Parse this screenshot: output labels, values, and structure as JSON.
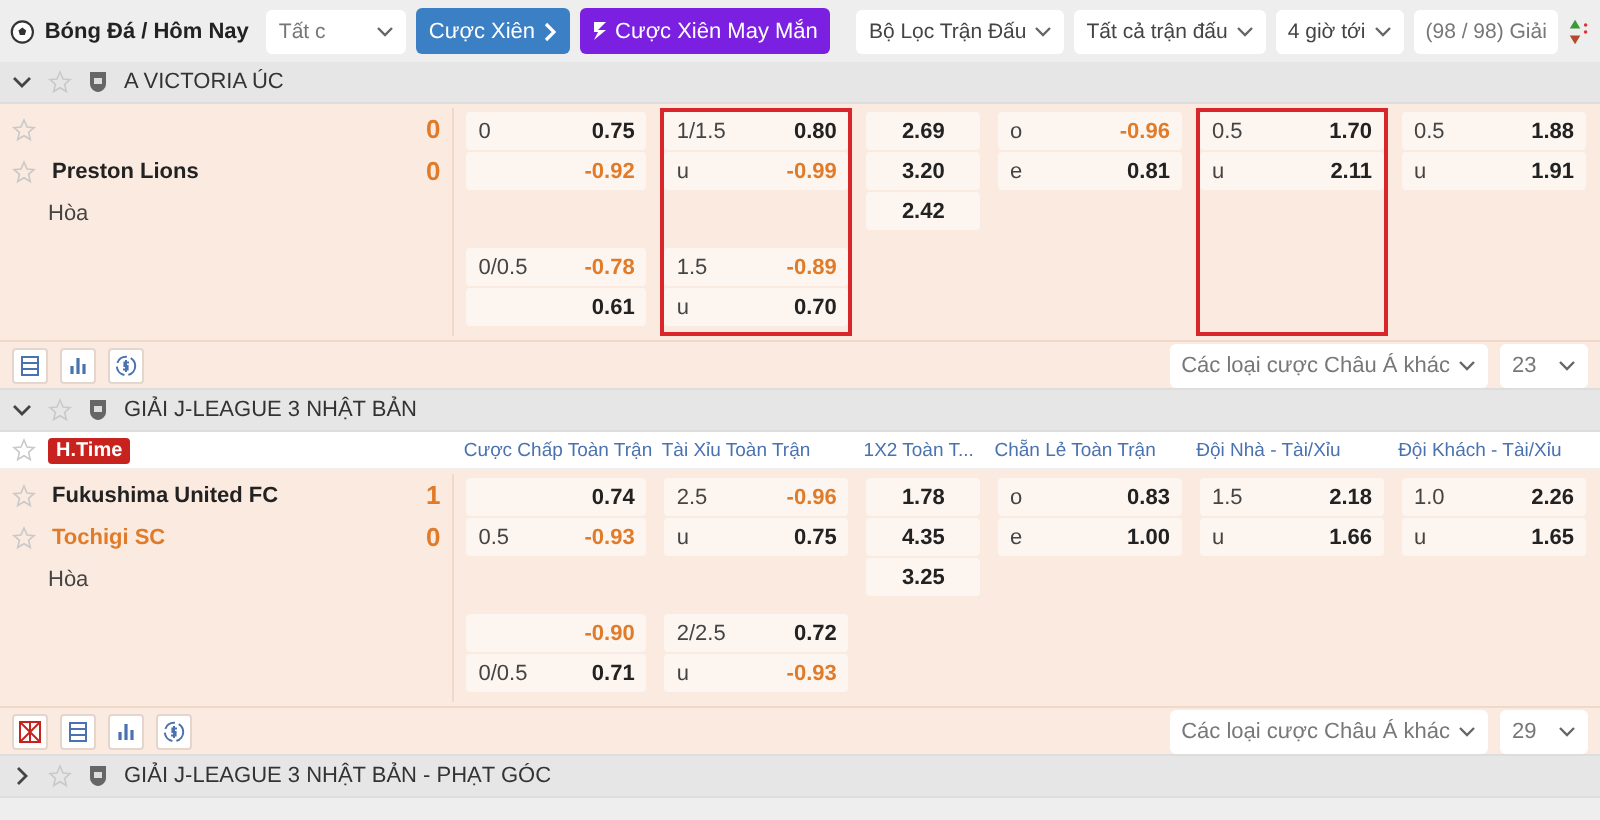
{
  "toolbar": {
    "breadcrumb": "Bóng Đá / Hôm Nay",
    "market_select": "Tất c",
    "buttons": [
      {
        "kind": "parlay",
        "label": "Cược Xiên"
      },
      {
        "kind": "lucky",
        "label": "Cược Xiên May Mắn"
      }
    ],
    "filters": [
      "Bộ Lọc Trận Đấu",
      "Tất cả trận đấu",
      "4 giờ tới"
    ],
    "league_count": "(98 / 98) Giải"
  },
  "leagues": [
    {
      "name": "A VICTORIA ÚC",
      "expanded": true,
      "matches": [
        {
          "teams": [
            {
              "score": "0",
              "highlighted": false
            },
            {
              "name": "Preston Lions",
              "score": "0",
              "highlighted": false
            }
          ],
          "draw_label": "Hòa",
          "markets": [
            {
              "highlighted": false,
              "blocks": [
                [
                  {
                    "label": "0",
                    "odds": "0.75",
                    "negative": false
                  },
                  {
                    "odds": "-0.92",
                    "negative": true
                  }
                ],
                [
                  {
                    "label": "0/0.5",
                    "odds": "-0.78",
                    "negative": true
                  },
                  {
                    "odds": "0.61",
                    "negative": false
                  }
                ]
              ]
            },
            {
              "highlighted": true,
              "blocks": [
                [
                  {
                    "label": "1/1.5",
                    "odds": "0.80",
                    "negative": false
                  },
                  {
                    "label": "u",
                    "odds": "-0.99",
                    "negative": true
                  }
                ],
                [
                  {
                    "label": "1.5",
                    "odds": "-0.89",
                    "negative": true
                  },
                  {
                    "label": "u",
                    "odds": "0.70",
                    "negative": false
                  }
                ]
              ]
            },
            {
              "highlighted": false,
              "blocks": [
                [
                  {
                    "odds": "2.69",
                    "negative": false
                  },
                  {
                    "odds": "3.20",
                    "negative": false
                  },
                  {
                    "odds": "2.42",
                    "negative": false
                  }
                ]
              ]
            },
            {
              "highlighted": false,
              "blocks": [
                [
                  {
                    "label": "o",
                    "odds": "-0.96",
                    "negative": true
                  },
                  {
                    "label": "e",
                    "odds": "0.81",
                    "negative": false
                  }
                ]
              ]
            },
            {
              "highlighted": true,
              "blocks": [
                [
                  {
                    "label": "0.5",
                    "odds": "1.70",
                    "negative": false
                  },
                  {
                    "label": "u",
                    "odds": "2.11",
                    "negative": false
                  }
                ]
              ]
            },
            {
              "highlighted": false,
              "blocks": [
                [
                  {
                    "label": "0.5",
                    "odds": "1.88",
                    "negative": false
                  },
                  {
                    "label": "u",
                    "odds": "1.91",
                    "negative": false
                  }
                ]
              ]
            }
          ]
        }
      ],
      "footer": {
        "chart_toggle": false,
        "bet_types": "Các loại cược Châu Á khác",
        "count": "23"
      }
    },
    {
      "name": "GIẢI J-LEAGUE 3 NHẬT BẢN",
      "expanded": true,
      "column_headers": [
        "Cược Chấp Toàn Trận",
        "Tài Xỉu Toàn Trận",
        "1X2 Toàn T...",
        "Chẵn Lẻ Toàn Trận",
        "Đội Nhà - Tài/Xỉu",
        "Đội Khách - Tài/Xỉu"
      ],
      "matches": [
        {
          "status": "H.Time",
          "teams": [
            {
              "name": "Fukushima United FC",
              "score": "1",
              "highlighted": false
            },
            {
              "name": "Tochigi SC",
              "score": "0",
              "highlighted": true
            }
          ],
          "draw_label": "Hòa",
          "markets": [
            {
              "highlighted": false,
              "blocks": [
                [
                  {
                    "odds": "0.74",
                    "negative": false
                  },
                  {
                    "label": "0.5",
                    "odds": "-0.93",
                    "negative": true
                  }
                ],
                [
                  {
                    "odds": "-0.90",
                    "negative": true
                  },
                  {
                    "label": "0/0.5",
                    "odds": "0.71",
                    "negative": false
                  }
                ]
              ]
            },
            {
              "highlighted": false,
              "blocks": [
                [
                  {
                    "label": "2.5",
                    "odds": "-0.96",
                    "negative": true
                  },
                  {
                    "label": "u",
                    "odds": "0.75",
                    "negative": false
                  }
                ],
                [
                  {
                    "label": "2/2.5",
                    "odds": "0.72",
                    "negative": false
                  },
                  {
                    "label": "u",
                    "odds": "-0.93",
                    "negative": true
                  }
                ]
              ]
            },
            {
              "highlighted": false,
              "blocks": [
                [
                  {
                    "odds": "1.78",
                    "negative": false
                  },
                  {
                    "odds": "4.35",
                    "negative": false
                  },
                  {
                    "odds": "3.25",
                    "negative": false
                  }
                ]
              ]
            },
            {
              "highlighted": false,
              "blocks": [
                [
                  {
                    "label": "o",
                    "odds": "0.83",
                    "negative": false
                  },
                  {
                    "label": "e",
                    "odds": "1.00",
                    "negative": false
                  }
                ]
              ]
            },
            {
              "highlighted": false,
              "blocks": [
                [
                  {
                    "label": "1.5",
                    "odds": "2.18",
                    "negative": false
                  },
                  {
                    "label": "u",
                    "odds": "1.66",
                    "negative": false
                  }
                ]
              ]
            },
            {
              "highlighted": false,
              "blocks": [
                [
                  {
                    "label": "1.0",
                    "odds": "2.26",
                    "negative": false
                  },
                  {
                    "label": "u",
                    "odds": "1.65",
                    "negative": false
                  }
                ]
              ]
            }
          ]
        }
      ],
      "footer": {
        "chart_toggle": true,
        "bet_types": "Các loại cược Châu Á khác",
        "count": "29"
      }
    },
    {
      "name": "GIẢI J-LEAGUE 3 NHẬT BẢN - PHẠT GÓC",
      "expanded": false
    }
  ]
}
